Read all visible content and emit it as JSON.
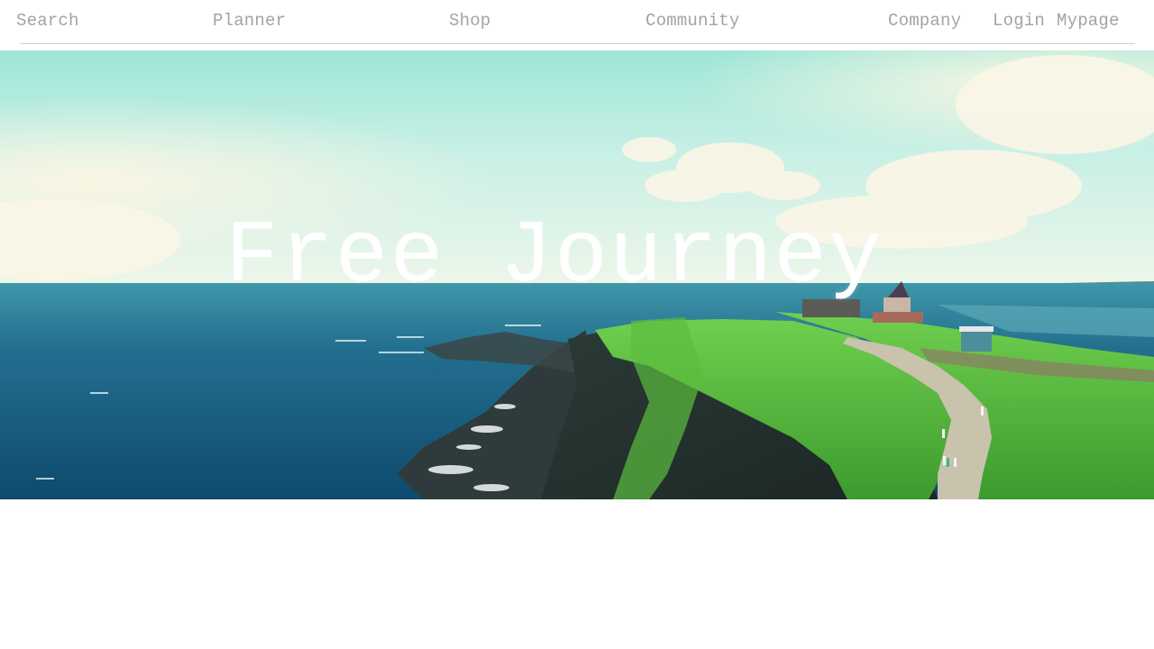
{
  "nav": {
    "search": "Search",
    "planner": "Planner",
    "shop": "Shop",
    "community": "Community",
    "company": "Company",
    "login": "Login",
    "mypage": "Mypage"
  },
  "hero": {
    "title": "Free Journey"
  }
}
